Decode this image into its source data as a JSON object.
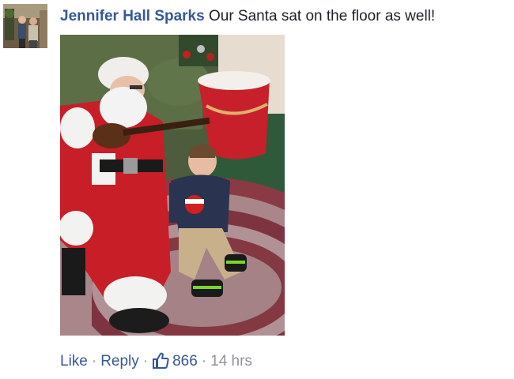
{
  "comment": {
    "author": "Jennifer Hall Sparks",
    "text": " Our Santa sat on the floor as well!",
    "actions": {
      "like_label": "Like",
      "reply_label": "Reply",
      "like_count": "866",
      "timestamp": "14 hrs"
    }
  },
  "icons": {
    "like": "thumbs-up-icon"
  },
  "colors": {
    "link": "#365899",
    "meta": "#90949c",
    "text": "#1d2129"
  }
}
